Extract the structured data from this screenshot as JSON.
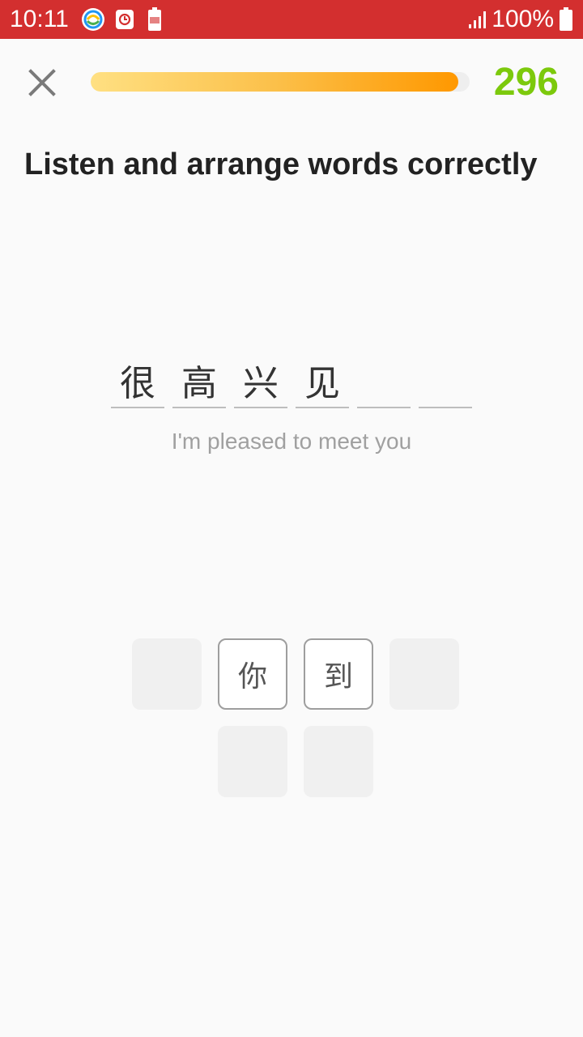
{
  "status_bar": {
    "time": "10:11",
    "battery_percent": "100%",
    "icons": [
      "app-notification-icon",
      "clock-icon",
      "battery-saver-icon",
      "signal-icon",
      "battery-icon"
    ],
    "color": "#d32f2f"
  },
  "header": {
    "close_icon": "close-icon",
    "progress": 0.97,
    "score": "296",
    "score_color": "#7cc90c"
  },
  "instruction": "Listen and arrange words correctly",
  "answer": {
    "slots": [
      "很",
      "高",
      "兴",
      "见",
      "",
      ""
    ],
    "translation": "I'm pleased to meet you"
  },
  "word_bank": {
    "tiles": [
      {
        "text": "",
        "state": "used"
      },
      {
        "text": "你",
        "state": "available"
      },
      {
        "text": "到",
        "state": "available"
      },
      {
        "text": "",
        "state": "used"
      },
      {
        "text": "",
        "state": "used"
      },
      {
        "text": "",
        "state": "used"
      }
    ]
  }
}
